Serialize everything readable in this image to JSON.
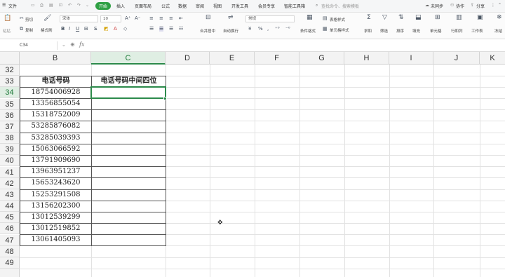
{
  "menubar": {
    "file": "文件",
    "tabs": [
      "开始",
      "插入",
      "页面布局",
      "公式",
      "数据",
      "审阅",
      "视图",
      "开发工具",
      "会员专享",
      "智能工具箱"
    ],
    "active_tab": "开始",
    "search_placeholder": "查找命令、搜索模板",
    "right": [
      "未同步",
      "协作",
      "分享"
    ]
  },
  "ribbon": {
    "cut": "剪切",
    "copy": "复制",
    "format_painter": "格式刷",
    "paste": "粘贴",
    "font_name": "宋体",
    "font_size": "10",
    "number_format": "常规",
    "merge_center": "合并居中",
    "wrap": "自动换行",
    "conditional": "条件格式",
    "table_style": "表格样式",
    "cell_style": "单元格样式",
    "sum": "求和",
    "filter": "筛选",
    "sort": "排序",
    "fill": "填充",
    "cell": "单元格",
    "rowcol": "行和列",
    "worksheet": "工作表",
    "freeze": "冻结"
  },
  "formula_bar": {
    "name_box": "C34",
    "fx": "fx",
    "value": ""
  },
  "columns": [
    "B",
    "C",
    "D",
    "E",
    "F",
    "G",
    "H",
    "I",
    "J",
    "K"
  ],
  "selected_column": "C",
  "rows": [
    "32",
    "33",
    "34",
    "35",
    "36",
    "37",
    "38",
    "39",
    "40",
    "41",
    "42",
    "43",
    "44",
    "45",
    "46",
    "47",
    "48",
    "49"
  ],
  "selected_row": "34",
  "table": {
    "header_b": "电话号码",
    "header_c": "电话号码中间四位",
    "phones": [
      "18754006928",
      "13356855054",
      "15318752009",
      "53285876082",
      "53285039393",
      "15063066592",
      "13791909690",
      "13963951237",
      "15653243620",
      "15253291508",
      "13156202300",
      "13012539299",
      "13012519852",
      "13061405093"
    ]
  }
}
